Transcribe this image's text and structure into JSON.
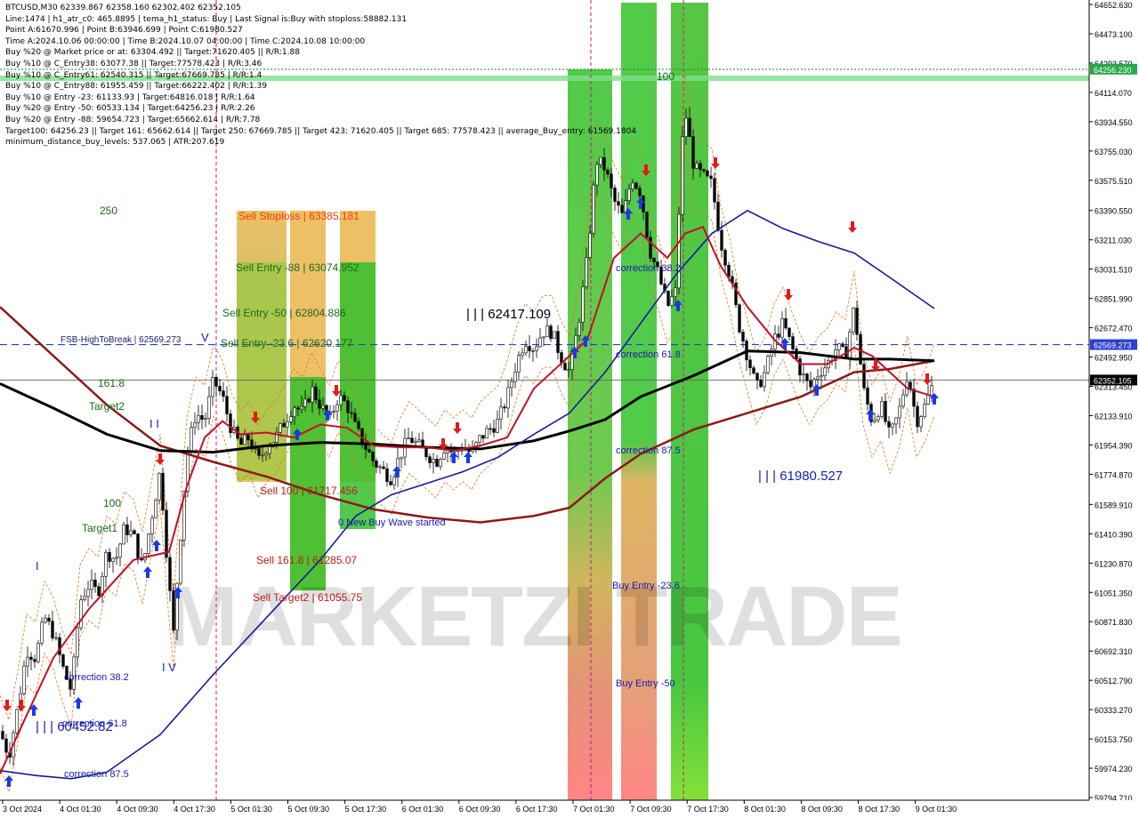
{
  "chart_data": {
    "type": "candlestick",
    "symbol_line": "BTCUSD,M30  62339.867 62358.160 62302.402 62352.105",
    "info_lines": [
      "Line:1474 | h1_atr_c0: 465.8895 | tema_h1_status: Buy | Last Signal is:Buy with stoploss:58882.131",
      "Point A:61670.996 | Point B:63946.699 | Point C:61980.527",
      "Time A:2024.10.06 00:00:00 | Time B:2024.10.07 04:00:00 | Time C:2024.10.08 10:00:00",
      "Buy %20 @ Market price or at: 63304.492 || Target:71620.405 || R/R:1.88",
      "Buy %10 @ C_Entry38: 63077.38 || Target:77578.423 | R/R:3.46",
      "Buy %10 @ C_Entry61: 62540.315 || Target:67669.785 | R/R:1.4",
      "Buy %10 @ C_Entry88: 61955.459 || Target:66222.402 | R/R:1.39",
      "Buy %10 @ Entry -23: 61133.93 | Target:64816.018 | R/R:1.64",
      "Buy %20 @ Entry -50: 60533.134 | Target:64256.23 | R/R:2.26",
      "Buy %20 @ Entry -88: 59654.723 | Target:65662.614 | R/R:7.78",
      "Target100: 64256.23 || Target 161: 65662.614 || Target 250: 67669.785 || Target 423: 71620.405 || Target 685: 77578.423 || average_Buy_entry: 61569.1804",
      "minimum_distance_buy_levels: 537.065 | ATR:207.619"
    ],
    "y_axis": {
      "ylim": [
        59794.71,
        64652.63
      ],
      "ticks": [
        64652.63,
        64473.1,
        64293.57,
        64114.07,
        63934.55,
        63755.03,
        63575.51,
        63390.55,
        63211.03,
        63031.51,
        62851.99,
        62672.47,
        62492.95,
        62313.45,
        62133.91,
        61954.39,
        61774.87,
        61589.91,
        61410.39,
        61230.87,
        61051.35,
        60871.83,
        60692.31,
        60512.79,
        60333.27,
        60153.75,
        59974.23,
        59794.71
      ],
      "tick_labels": [
        "64652.630",
        "64473.100",
        "64293.570",
        "64114.070",
        "63934.550",
        "63755.030",
        "63575.510",
        "63390.550",
        "63211.030",
        "63031.510",
        "62851.990",
        "62672.470",
        "62492.950",
        "62313.450",
        "62133.910",
        "61954.390",
        "61774.870",
        "61589.910",
        "61410.390",
        "61230.870",
        "61051.350",
        "60871.830",
        "60692.310",
        "60512.790",
        "60333.270",
        "60153.750",
        "59974.230",
        "59794.710"
      ],
      "price_tags": [
        {
          "value": 64256.23,
          "label": "64256.230",
          "color": "#27a84a"
        },
        {
          "value": 62569.273,
          "label": "62569.273",
          "color": "#2b3fd6"
        },
        {
          "value": 62352.105,
          "label": "62352.105",
          "color": "#000000"
        }
      ]
    },
    "x_axis": {
      "tick_labels": [
        "3 Oct 2024",
        "4 Oct 01:30",
        "4 Oct 09:30",
        "4 Oct 17:30",
        "5 Oct 01:30",
        "5 Oct 09:30",
        "5 Oct 17:30",
        "6 Oct 01:30",
        "6 Oct 09:30",
        "6 Oct 17:30",
        "7 Oct 01:30",
        "7 Oct 09:30",
        "7 Oct 17:30",
        "8 Oct 01:30",
        "8 Oct 09:30",
        "8 Oct 17:30",
        "9 Oct 01:30"
      ]
    },
    "price_points": [
      [
        0,
        60200
      ],
      [
        10,
        60050
      ],
      [
        20,
        60350
      ],
      [
        30,
        60700
      ],
      [
        40,
        60650
      ],
      [
        50,
        60900
      ],
      [
        60,
        60800
      ],
      [
        70,
        60600
      ],
      [
        80,
        60450
      ],
      [
        90,
        61000
      ],
      [
        100,
        61100
      ],
      [
        110,
        61050
      ],
      [
        120,
        61300
      ],
      [
        130,
        61250
      ],
      [
        140,
        61450
      ],
      [
        150,
        61400
      ],
      [
        160,
        61200
      ],
      [
        170,
        61500
      ],
      [
        180,
        61800
      ],
      [
        190,
        61100
      ],
      [
        195,
        60800
      ],
      [
        200,
        61200
      ],
      [
        210,
        61900
      ],
      [
        220,
        62150
      ],
      [
        230,
        62100
      ],
      [
        240,
        62350
      ],
      [
        250,
        62250
      ],
      [
        260,
        62050
      ],
      [
        270,
        61950
      ],
      [
        280,
        62000
      ],
      [
        290,
        61850
      ],
      [
        300,
        61950
      ],
      [
        310,
        62000
      ],
      [
        320,
        62100
      ],
      [
        330,
        62200
      ],
      [
        340,
        62150
      ],
      [
        350,
        62300
      ],
      [
        360,
        62200
      ],
      [
        370,
        62100
      ],
      [
        380,
        62250
      ],
      [
        390,
        62200
      ],
      [
        400,
        62050
      ],
      [
        410,
        61950
      ],
      [
        420,
        61850
      ],
      [
        430,
        61800
      ],
      [
        440,
        61750
      ],
      [
        450,
        61900
      ],
      [
        460,
        62000
      ],
      [
        470,
        61950
      ],
      [
        480,
        61900
      ],
      [
        490,
        61850
      ],
      [
        500,
        61950
      ],
      [
        510,
        61900
      ],
      [
        520,
        61950
      ],
      [
        530,
        61900
      ],
      [
        540,
        62000
      ],
      [
        550,
        62050
      ],
      [
        560,
        62100
      ],
      [
        570,
        62250
      ],
      [
        580,
        62450
      ],
      [
        590,
        62600
      ],
      [
        600,
        62550
      ],
      [
        610,
        62650
      ],
      [
        620,
        62650
      ],
      [
        630,
        62500
      ],
      [
        640,
        62400
      ],
      [
        650,
        62700
      ],
      [
        660,
        63100
      ],
      [
        670,
        63700
      ],
      [
        680,
        63650
      ],
      [
        690,
        63450
      ],
      [
        700,
        63350
      ],
      [
        710,
        63600
      ],
      [
        720,
        63500
      ],
      [
        730,
        63150
      ],
      [
        740,
        63000
      ],
      [
        750,
        62800
      ],
      [
        760,
        62900
      ],
      [
        765,
        63700
      ],
      [
        770,
        64000
      ],
      [
        780,
        63650
      ],
      [
        790,
        63600
      ],
      [
        800,
        63550
      ],
      [
        810,
        63200
      ],
      [
        820,
        63000
      ],
      [
        830,
        62700
      ],
      [
        840,
        62500
      ],
      [
        850,
        62300
      ],
      [
        860,
        62400
      ],
      [
        870,
        62600
      ],
      [
        880,
        62700
      ],
      [
        890,
        62550
      ],
      [
        900,
        62400
      ],
      [
        910,
        62300
      ],
      [
        920,
        62400
      ],
      [
        930,
        62450
      ],
      [
        940,
        62550
      ],
      [
        950,
        62500
      ],
      [
        960,
        62800
      ],
      [
        970,
        62300
      ],
      [
        980,
        62100
      ],
      [
        990,
        62200
      ],
      [
        1000,
        62000
      ],
      [
        1010,
        62150
      ],
      [
        1020,
        62400
      ],
      [
        1030,
        62100
      ],
      [
        1040,
        62200
      ],
      [
        1050,
        62352
      ]
    ],
    "moving_averages": [
      {
        "name": "slow-ma-darkred",
        "color": "#8b1a1a",
        "points": [
          [
            0,
            62800
          ],
          [
            60,
            62500
          ],
          [
            120,
            62200
          ],
          [
            180,
            61950
          ],
          [
            240,
            61850
          ],
          [
            300,
            61760
          ],
          [
            360,
            61650
          ],
          [
            420,
            61560
          ],
          [
            480,
            61510
          ],
          [
            540,
            61480
          ],
          [
            600,
            61520
          ],
          [
            640,
            61570
          ],
          [
            680,
            61750
          ],
          [
            720,
            61900
          ],
          [
            780,
            62050
          ],
          [
            840,
            62150
          ],
          [
            900,
            62250
          ],
          [
            960,
            62400
          ],
          [
            1000,
            62420
          ],
          [
            1050,
            62470
          ]
        ]
      },
      {
        "name": "ma-black",
        "color": "#000000",
        "points": [
          [
            0,
            62330
          ],
          [
            60,
            62180
          ],
          [
            120,
            62020
          ],
          [
            180,
            61920
          ],
          [
            240,
            61910
          ],
          [
            300,
            61950
          ],
          [
            360,
            61970
          ],
          [
            420,
            61960
          ],
          [
            480,
            61940
          ],
          [
            540,
            61930
          ],
          [
            600,
            61980
          ],
          [
            640,
            62040
          ],
          [
            680,
            62110
          ],
          [
            720,
            62250
          ],
          [
            780,
            62380
          ],
          [
            840,
            62530
          ],
          [
            900,
            62520
          ],
          [
            960,
            62480
          ],
          [
            1000,
            62480
          ],
          [
            1050,
            62470
          ]
        ]
      },
      {
        "name": "ma-blue",
        "color": "#1a1a9a",
        "points": [
          [
            0,
            59960
          ],
          [
            40,
            59930
          ],
          [
            80,
            59910
          ],
          [
            120,
            59950
          ],
          [
            180,
            60180
          ],
          [
            240,
            60550
          ],
          [
            300,
            60900
          ],
          [
            360,
            61250
          ],
          [
            400,
            61520
          ],
          [
            440,
            61650
          ],
          [
            480,
            61720
          ],
          [
            520,
            61790
          ],
          [
            560,
            61880
          ],
          [
            600,
            62020
          ],
          [
            640,
            62150
          ],
          [
            680,
            62400
          ],
          [
            720,
            62700
          ],
          [
            760,
            63000
          ],
          [
            800,
            63250
          ],
          [
            840,
            63390
          ],
          [
            880,
            63280
          ],
          [
            920,
            63200
          ],
          [
            960,
            63130
          ],
          [
            1000,
            62980
          ],
          [
            1050,
            62790
          ]
        ]
      },
      {
        "name": "tema-red",
        "color": "#c0102a",
        "points": [
          [
            0,
            59940
          ],
          [
            30,
            60300
          ],
          [
            60,
            60650
          ],
          [
            100,
            60950
          ],
          [
            150,
            61250
          ],
          [
            190,
            61300
          ],
          [
            210,
            61700
          ],
          [
            230,
            62000
          ],
          [
            250,
            62100
          ],
          [
            270,
            62020
          ],
          [
            300,
            62030
          ],
          [
            330,
            62000
          ],
          [
            360,
            62080
          ],
          [
            390,
            62060
          ],
          [
            420,
            61950
          ],
          [
            450,
            61940
          ],
          [
            480,
            61940
          ],
          [
            510,
            61920
          ],
          [
            540,
            61950
          ],
          [
            570,
            62000
          ],
          [
            600,
            62300
          ],
          [
            630,
            62450
          ],
          [
            660,
            62600
          ],
          [
            690,
            63100
          ],
          [
            720,
            63250
          ],
          [
            750,
            63100
          ],
          [
            770,
            63250
          ],
          [
            790,
            63290
          ],
          [
            810,
            63050
          ],
          [
            840,
            62800
          ],
          [
            870,
            62600
          ],
          [
            900,
            62450
          ],
          [
            930,
            62450
          ],
          [
            960,
            62550
          ],
          [
            980,
            62500
          ],
          [
            1000,
            62400
          ],
          [
            1020,
            62300
          ],
          [
            1050,
            62250
          ]
        ]
      }
    ],
    "annotations": {
      "sell_levels": [
        {
          "text": "Sell Stoploss | 63385.181",
          "color": "#ff3a00"
        },
        {
          "text": "Sell Entry -88 | 63074.952",
          "color": "#1a6a1a"
        },
        {
          "text": "Sell Entry -50 | 62804.886",
          "color": "#1a6a1a"
        },
        {
          "text": "Sell Entry -23.6 | 62620.177",
          "color": "#1a6a1a"
        },
        {
          "text": "Sell 100 | 61717.456",
          "color": "#c01a1a"
        },
        {
          "text": "Sell 161.8 | 61285.07",
          "color": "#c01a1a"
        },
        {
          "text": "Sell Target2 | 61055.75",
          "color": "#c01a1a"
        }
      ],
      "buy_levels": [
        {
          "text": "correction 38.2",
          "color": "#1a1ab0"
        },
        {
          "text": "correction 61.8",
          "color": "#1a1ab0"
        },
        {
          "text": "correction 87.5",
          "color": "#1a1ab0"
        },
        {
          "text": "Buy Entry -23.6",
          "color": "#1a1ab0"
        },
        {
          "text": "Buy Entry -50",
          "color": "#1a1ab0"
        }
      ],
      "left_labels": [
        {
          "text": "250",
          "color": "#1a6a1a"
        },
        {
          "text": "161.8",
          "color": "#1a6a1a"
        },
        {
          "text": "Target2",
          "color": "#1a6a1a"
        },
        {
          "text": "100",
          "color": "#1a6a1a"
        },
        {
          "text": "Target1",
          "color": "#1a6a1a"
        },
        {
          "text": "100",
          "color": "#1a6a1a"
        }
      ],
      "fsb_label": "FSB-HighToBreak | 62569.273",
      "wave_labels": [
        "| | | 62417.109",
        "| | | 61980.527",
        "| | | 60452.82",
        "I V",
        "I I",
        "I",
        "V"
      ],
      "small_corrections": [
        "correction 38.2",
        "correction 61.8",
        "correction 87.5"
      ],
      "new_wave": "0 New Buy Wave started"
    },
    "watermark": "MARKETZI TRADE",
    "colors": {
      "background": "#ffffff",
      "bull": "#000000",
      "bear": "#000000",
      "green_zone": "#33c02a",
      "orange_zone": "#e0a040",
      "red_zone": "#ff6a6a"
    }
  }
}
